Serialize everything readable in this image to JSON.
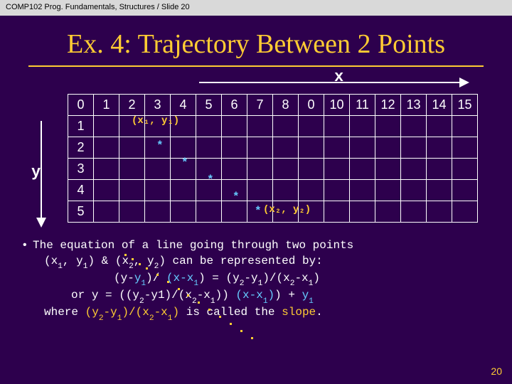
{
  "header": "COMP102 Prog. Fundamentals, Structures / Slide 20",
  "title": "Ex. 4: Trajectory Between 2 Points",
  "axes": {
    "x": "x",
    "y": "y"
  },
  "grid": {
    "cols": [
      "0",
      "1",
      "2",
      "3",
      "4",
      "5",
      "6",
      "7",
      "8",
      "0",
      "10",
      "11",
      "12",
      "13",
      "14",
      "15"
    ],
    "rows": [
      "1",
      "2",
      "3",
      "4",
      "5"
    ]
  },
  "points": {
    "p1": "(x₁, y₁)",
    "p2": "(x₂, y₂)"
  },
  "body": {
    "line1a": "The equation of a line going through two points",
    "line1b": " (x",
    "line1c": ", y",
    "line1d": ") & (x",
    "line1e": ", y",
    "line1f": ") can be represented by:",
    "eq1a": "(y-",
    "eq1_y1": "y",
    "eq1b": ")/ ",
    "eq1_paren": "(x-x",
    "eq1c": ") = (y",
    "eq1d": "-y",
    "eq1e": ")/(x",
    "eq1f": "-x",
    "eq1g": ")",
    "line_or": "or ",
    "eq2a": "y = ((y",
    "eq2b": "-y1)/(x",
    "eq2c": "-x",
    "eq2d": ")) ",
    "eq2_paren": "(x-x",
    "eq2e": ") + ",
    "eq2_y1": "y",
    "where": "where ",
    "slope_expr_a": "(y",
    "slope_expr_b": "-y",
    "slope_expr_c": ")/(x",
    "slope_expr_d": "-x",
    "slope_expr_e": ")",
    "slope_txt": " is called the ",
    "slope_word": "slope",
    "dot": "."
  },
  "sub": {
    "1": "1",
    "2": "2"
  },
  "page": "20"
}
